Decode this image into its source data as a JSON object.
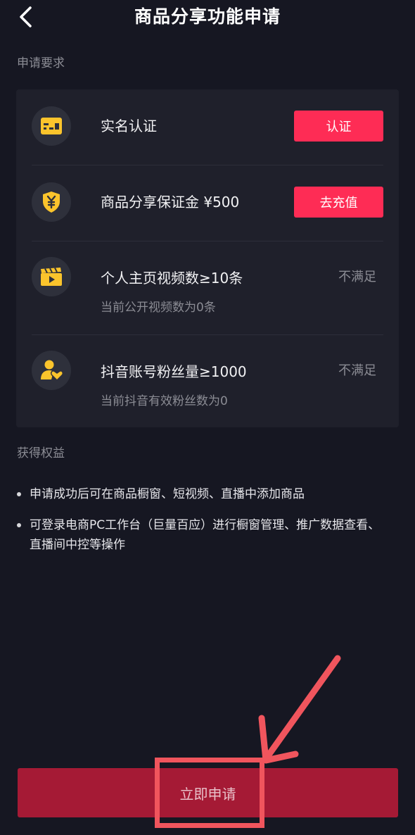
{
  "header": {
    "title": "商品分享功能申请",
    "back_icon": "chevron-left-icon"
  },
  "requirements": {
    "section_title": "申请要求",
    "items": [
      {
        "icon": "id-card-icon",
        "label": "实名认证",
        "action_label": "认证"
      },
      {
        "icon": "yen-shield-icon",
        "label": "商品分享保证金 ¥500",
        "action_label": "去充值"
      },
      {
        "icon": "video-clapper-icon",
        "label": "个人主页视频数≥10条",
        "status": "不满足",
        "sub": "当前公开视频数为0条"
      },
      {
        "icon": "fans-heart-icon",
        "label": "抖音账号粉丝量≥1000",
        "status": "不满足",
        "sub": "当前抖音有效粉丝数为0"
      }
    ]
  },
  "benefits": {
    "section_title": "获得权益",
    "items": [
      "申请成功后可在商品橱窗、短视频、直播中添加商品",
      "可登录电商PC工作台（巨量百应）进行橱窗管理、推广数据查看、直播间中控等操作"
    ]
  },
  "footer": {
    "apply_label": "立即申请"
  },
  "colors": {
    "background": "#161722",
    "card": "#1f202b",
    "accent": "#fe2c55",
    "icon_yellow": "#fbc42c",
    "apply_button": "#a51a35",
    "annotation": "#f0555d"
  }
}
